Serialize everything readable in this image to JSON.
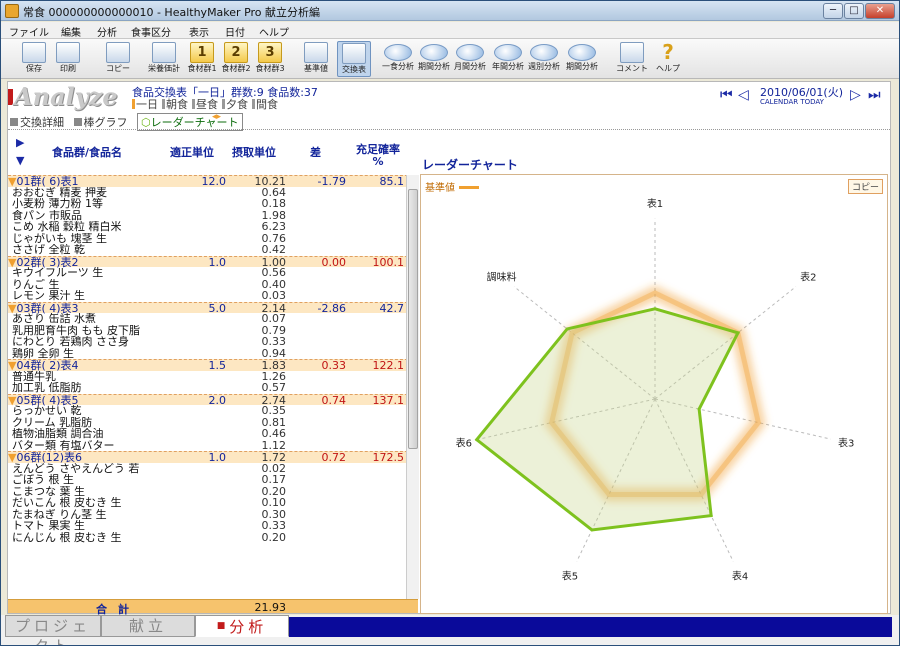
{
  "window": {
    "title": "常食 000000000000010 - HealthyMaker Pro 献立分析編",
    "minimize": "─",
    "maximize": "□",
    "close": "✕"
  },
  "menu": [
    "ファイル",
    "編集",
    "分析",
    "食事区分",
    "表示",
    "日付",
    "ヘルプ"
  ],
  "toolbar": [
    {
      "label": "保存",
      "kind": "icon"
    },
    {
      "label": "印刷",
      "kind": "icon"
    },
    {
      "label": "コピー",
      "kind": "icon"
    },
    {
      "label": "栄養価計",
      "kind": "icon"
    },
    {
      "label": "食材群1",
      "kind": "num",
      "num": "1"
    },
    {
      "label": "食材群2",
      "kind": "num",
      "num": "2"
    },
    {
      "label": "食材群3",
      "kind": "num",
      "num": "3"
    },
    {
      "label": "基準値",
      "kind": "icon"
    },
    {
      "label": "交換表",
      "kind": "icon",
      "active": true
    },
    {
      "label": "一食分析",
      "kind": "blob"
    },
    {
      "label": "期間分析",
      "kind": "blob"
    },
    {
      "label": "月間分析",
      "kind": "blob"
    },
    {
      "label": "年間分析",
      "kind": "blob"
    },
    {
      "label": "週別分析",
      "kind": "blob"
    },
    {
      "label": "期間分析",
      "kind": "blob"
    },
    {
      "label": "コメント",
      "kind": "icon"
    },
    {
      "label": "ヘルプ",
      "kind": "help"
    }
  ],
  "header": {
    "logo": "Analyze",
    "title": "食品交換表「一日」群数:9 食品数:37",
    "meals": [
      {
        "label": "一日",
        "active": true
      },
      {
        "label": "朝食"
      },
      {
        "label": "昼食"
      },
      {
        "label": "夕食"
      },
      {
        "label": "間食"
      }
    ],
    "date": "2010/06/01(火)",
    "date_sub": "CALENDAR TODAY"
  },
  "subtabs": [
    "交換詳細",
    "棒グラフ",
    "レーダーチャート"
  ],
  "table": {
    "headers": [
      "食品群/食品名",
      "適正単位",
      "摂取単位",
      "差",
      "充足確率 %"
    ],
    "rows": [
      {
        "type": "group",
        "name": "01群( 6)表1",
        "proper": "12.0",
        "intake": "10.21",
        "diff": "-1.79",
        "rate": "85.1",
        "color": "blue"
      },
      {
        "type": "item",
        "name": "おおむぎ 精麦 押麦",
        "intake": "0.64"
      },
      {
        "type": "item",
        "name": "小麦粉 薄力粉 1等",
        "intake": "0.18"
      },
      {
        "type": "item",
        "name": "食パン 市販品",
        "intake": "1.98"
      },
      {
        "type": "item",
        "name": "こめ 水稲 穀粒 精白米",
        "intake": "6.23"
      },
      {
        "type": "item",
        "name": "じゃがいも 塊茎 生",
        "intake": "0.76"
      },
      {
        "type": "item",
        "name": "ささげ 全粒 乾",
        "intake": "0.42"
      },
      {
        "type": "group",
        "name": "02群( 3)表2",
        "proper": "1.0",
        "intake": "1.00",
        "diff": "0.00",
        "rate": "100.1",
        "color": "red"
      },
      {
        "type": "item",
        "name": "キウイフルーツ 生",
        "intake": "0.56"
      },
      {
        "type": "item",
        "name": "りんご 生",
        "intake": "0.40"
      },
      {
        "type": "item",
        "name": "レモン 果汁 生",
        "intake": "0.03"
      },
      {
        "type": "group",
        "name": "03群( 4)表3",
        "proper": "5.0",
        "intake": "2.14",
        "diff": "-2.86",
        "rate": "42.7",
        "color": "blue"
      },
      {
        "type": "item",
        "name": "あさり 缶詰 水煮",
        "intake": "0.07"
      },
      {
        "type": "item",
        "name": "乳用肥育牛肉 もも 皮下脂",
        "intake": "0.79"
      },
      {
        "type": "item",
        "name": "にわとり 若鶏肉 ささ身",
        "intake": "0.33"
      },
      {
        "type": "item",
        "name": "鶏卵 全卵 生",
        "intake": "0.94"
      },
      {
        "type": "group",
        "name": "04群( 2)表4",
        "proper": "1.5",
        "intake": "1.83",
        "diff": "0.33",
        "rate": "122.1",
        "color": "red"
      },
      {
        "type": "item",
        "name": "普通牛乳",
        "intake": "1.26"
      },
      {
        "type": "item",
        "name": "加工乳 低脂肪",
        "intake": "0.57"
      },
      {
        "type": "group",
        "name": "05群( 4)表5",
        "proper": "2.0",
        "intake": "2.74",
        "diff": "0.74",
        "rate": "137.1",
        "color": "red"
      },
      {
        "type": "item",
        "name": "らっかせい 乾",
        "intake": "0.35"
      },
      {
        "type": "item",
        "name": "クリーム 乳脂肪",
        "intake": "0.81"
      },
      {
        "type": "item",
        "name": "植物油脂類 調合油",
        "intake": "0.46"
      },
      {
        "type": "item",
        "name": "バター類 有塩バター",
        "intake": "1.12"
      },
      {
        "type": "group",
        "name": "06群(12)表6",
        "proper": "1.0",
        "intake": "1.72",
        "diff": "0.72",
        "rate": "172.5",
        "color": "red"
      },
      {
        "type": "item",
        "name": "えんどう さやえんどう 若",
        "intake": "0.02"
      },
      {
        "type": "item",
        "name": "ごぼう 根 生",
        "intake": "0.17"
      },
      {
        "type": "item",
        "name": "こまつな 葉 生",
        "intake": "0.20"
      },
      {
        "type": "item",
        "name": "だいこん 根 皮むき 生",
        "intake": "0.10"
      },
      {
        "type": "item",
        "name": "たまねぎ りん茎 生",
        "intake": "0.30"
      },
      {
        "type": "item",
        "name": "トマト 果実 生",
        "intake": "0.33"
      },
      {
        "type": "item",
        "name": "にんじん 根 皮むき 生",
        "intake": "0.20"
      }
    ],
    "total_label": "合　計",
    "total_value": "21.93"
  },
  "chart_data": {
    "type": "radar",
    "title": "レーダーチャート",
    "categories": [
      "表1",
      "表2",
      "表3",
      "表4",
      "表5",
      "表6",
      "調味料"
    ],
    "series": [
      {
        "name": "基準値",
        "values": [
          100,
          100,
          100,
          100,
          100,
          100,
          100
        ],
        "color": "#f0a030"
      },
      {
        "name": "",
        "values": [
          85.1,
          100.1,
          42.7,
          122.1,
          137.1,
          172.5,
          106
        ],
        "color": "#7ec21e"
      }
    ],
    "range": [
      0,
      200
    ],
    "legend": "top-left",
    "copy_label": "コピー"
  },
  "bottom_tabs": [
    {
      "label": "プロジェクト"
    },
    {
      "label": "献立"
    },
    {
      "label": "分析",
      "active": true
    }
  ]
}
